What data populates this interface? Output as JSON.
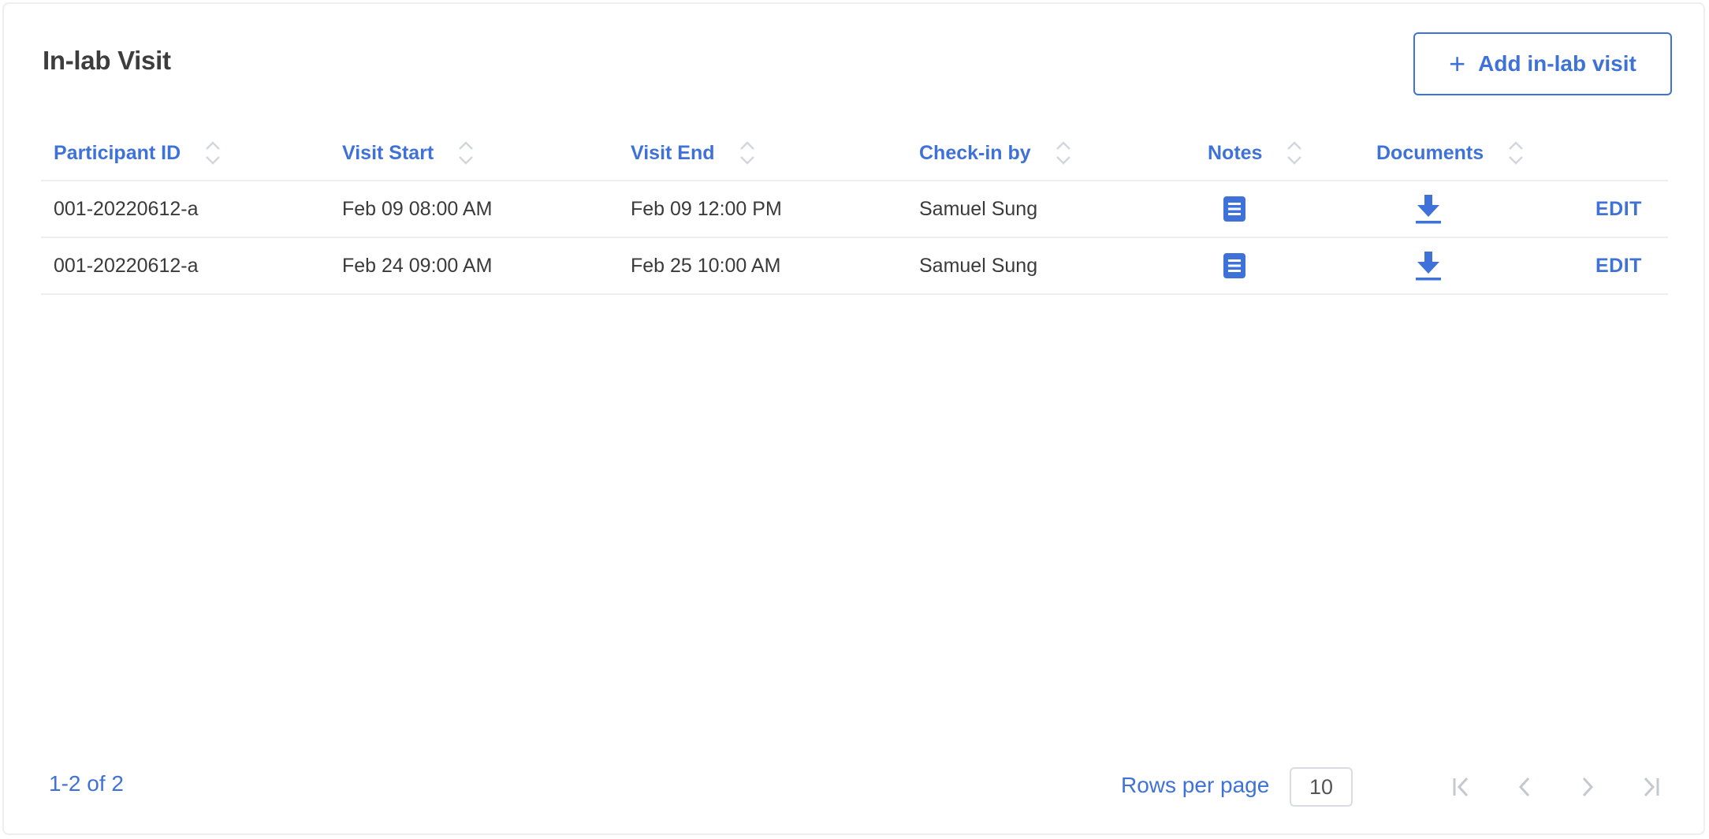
{
  "header": {
    "title": "In-lab Visit",
    "add_button_label": "Add in-lab visit",
    "add_button_icon": "plus-icon"
  },
  "table": {
    "columns": [
      "Participant ID",
      "Visit Start",
      "Visit End",
      "Check-in by",
      "Notes",
      "Documents"
    ],
    "rows": [
      {
        "participant_id": "001-20220612-a",
        "visit_start": "Feb 09 08:00 AM",
        "visit_end": "Feb 09 12:00 PM",
        "check_in_by": "Samuel Sung",
        "notes_icon": "notes-icon",
        "documents_icon": "download-icon",
        "action": "EDIT"
      },
      {
        "participant_id": "001-20220612-a",
        "visit_start": "Feb 24 09:00 AM",
        "visit_end": "Feb 25 10:00 AM",
        "check_in_by": "Samuel Sung",
        "notes_icon": "notes-icon",
        "documents_icon": "download-icon",
        "action": "EDIT"
      }
    ]
  },
  "footer": {
    "count": "1-2 of 2",
    "rows_per_page_label": "Rows per page",
    "rows_per_page_value": "10"
  },
  "colors": {
    "accent": "#3f72d9",
    "text": "#3a3a3a",
    "border": "#eceef2",
    "pager_disabled": "#c4c8d0"
  }
}
